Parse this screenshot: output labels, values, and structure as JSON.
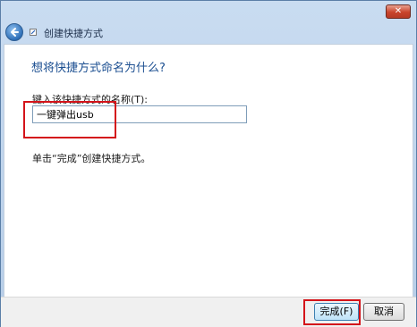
{
  "titlebar": {
    "close_glyph": "✕"
  },
  "nav": {
    "title": "创建快捷方式",
    "back_icon": "back-arrow-icon",
    "app_icon": "shortcut-icon"
  },
  "main": {
    "heading": "想将快捷方式命名为什么?",
    "field_label": "键入该快捷方式的名称(T):",
    "name_value": "一键弹出usb",
    "hint": "单击“完成”创建快捷方式。"
  },
  "footer": {
    "finish_label": "完成(F)",
    "cancel_label": "取消"
  },
  "colors": {
    "heading": "#1c4f91",
    "highlight": "#d4141a"
  }
}
